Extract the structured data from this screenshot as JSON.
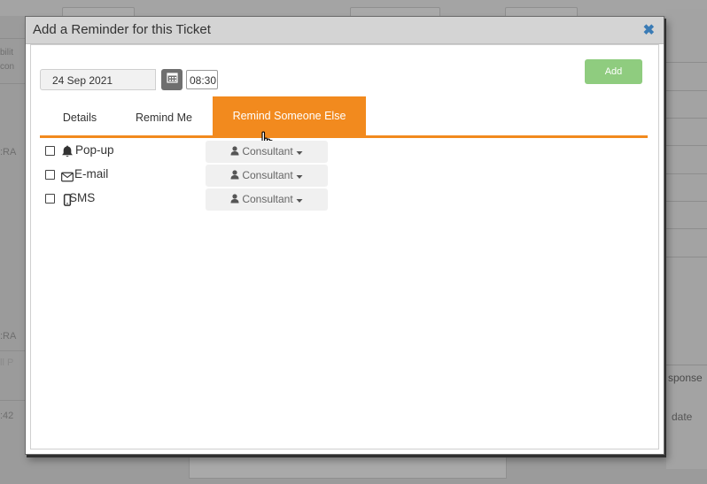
{
  "background": {
    "left_texts": [
      "bilit",
      "con",
      ":RA",
      ":RA",
      "ll P",
      ":42"
    ],
    "right_texts": [
      "sponse",
      "date"
    ]
  },
  "modal": {
    "title": "Add a Reminder for this Ticket",
    "close_glyph": "✖",
    "date_value": "24 Sep 2021",
    "time_value": "08:30",
    "add_label": "Add",
    "tabs": [
      {
        "label": "Details",
        "active": false
      },
      {
        "label": "Remind Me",
        "active": false
      },
      {
        "label": "Remind Someone Else",
        "active": true
      }
    ],
    "reminders": [
      {
        "label": "Pop-up",
        "icon": "bell-icon",
        "checked": false,
        "recipient": "Consultant"
      },
      {
        "label": "E-mail",
        "icon": "envelope-icon",
        "checked": false,
        "recipient": "Consultant"
      },
      {
        "label": "SMS",
        "icon": "mobile-icon",
        "checked": false,
        "recipient": "Consultant"
      }
    ]
  },
  "colors": {
    "accent_orange": "#f28a1e",
    "add_button_green": "#8fcc7f",
    "close_blue": "#3a7bb5"
  }
}
